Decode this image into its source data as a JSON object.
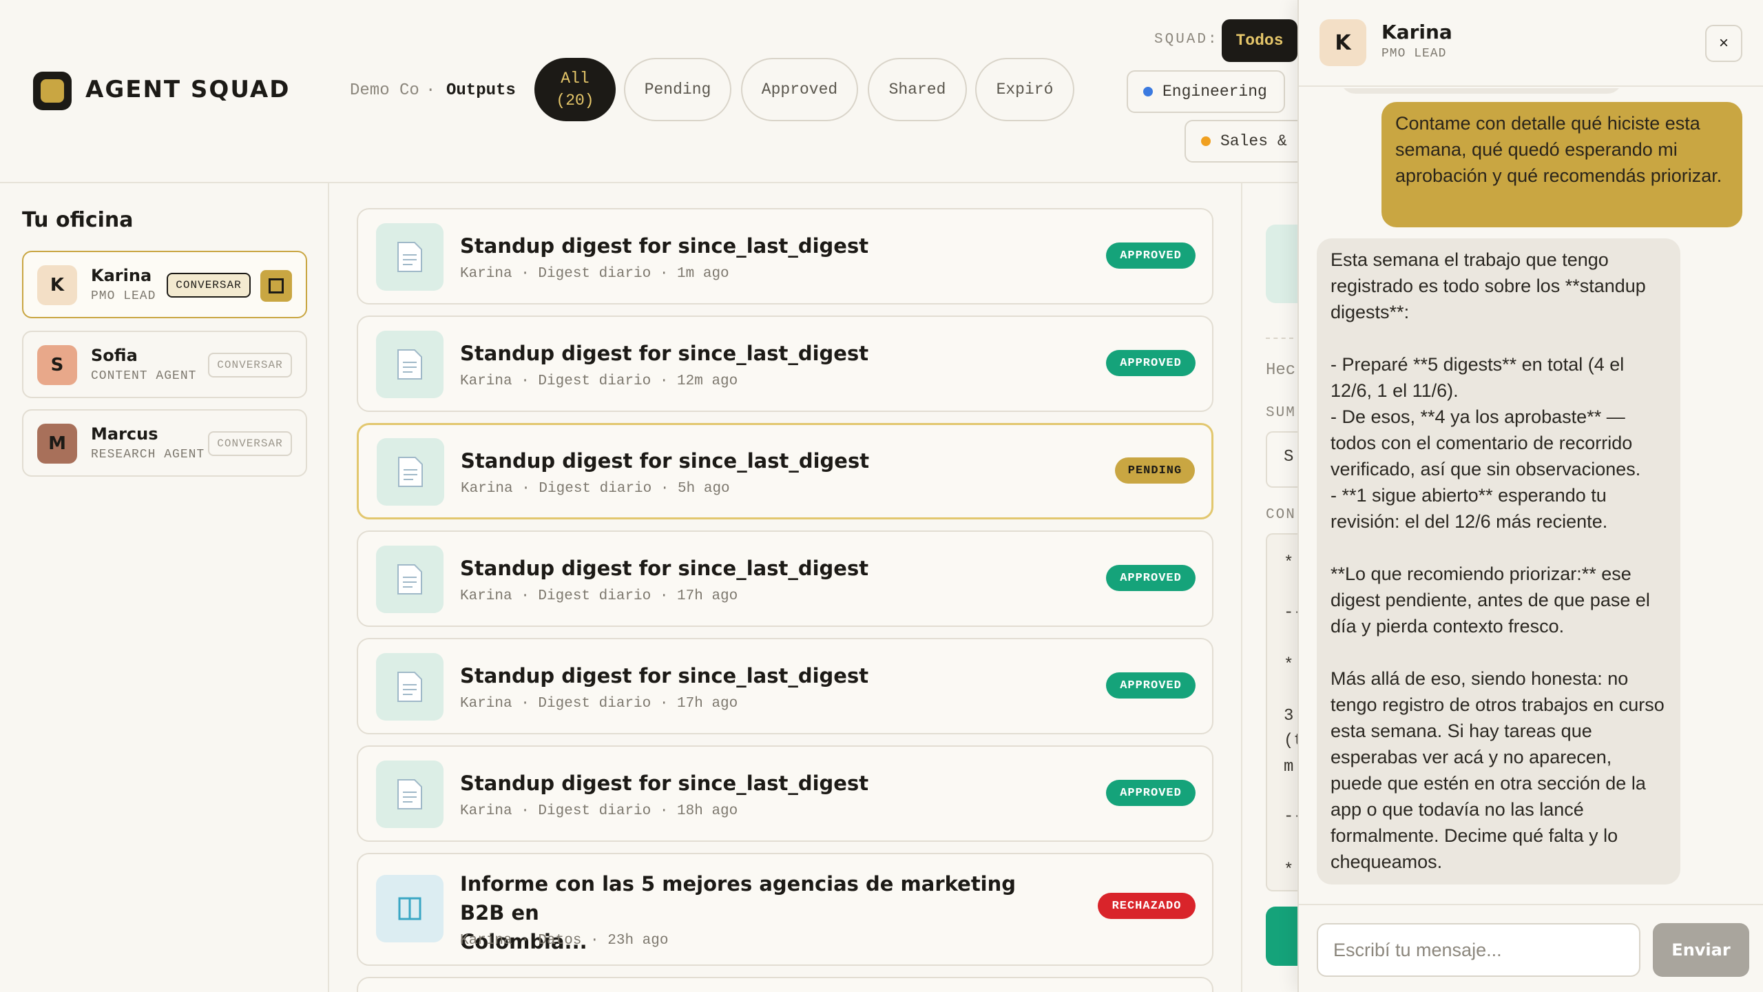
{
  "header": {
    "brand": "AGENT SQUAD",
    "org": "Demo Co",
    "separator": "·",
    "page": "Outputs",
    "filters": [
      {
        "label": "All\n(20)",
        "active": true
      },
      {
        "label": "Pending",
        "active": false
      },
      {
        "label": "Approved",
        "active": false
      },
      {
        "label": "Shared",
        "active": false
      },
      {
        "label": "Expiró",
        "active": false
      }
    ],
    "squad_label": "SQUAD:",
    "squad_selected": "Todos",
    "squads": [
      {
        "label": "Engineering",
        "color": "#3b7ae0"
      },
      {
        "label": "Sales &",
        "color": "#f0a020"
      }
    ]
  },
  "sidebar": {
    "title": "Tu oficina",
    "agents": [
      {
        "initial": "K",
        "name": "Karina",
        "role": "PMO LEAD",
        "action": "CONVERSAR",
        "selected": true,
        "avatar_bg": "#f3dfc6",
        "avatar_fg": "#1c1a16"
      },
      {
        "initial": "S",
        "name": "Sofia",
        "role": "CONTENT AGENT",
        "action": "CONVERSAR",
        "selected": false,
        "avatar_bg": "#e8a88a",
        "avatar_fg": "#1c1a16"
      },
      {
        "initial": "M",
        "name": "Marcus",
        "role": "RESEARCH AGENT",
        "action": "CONVERSAR",
        "selected": false,
        "avatar_bg": "#a8705a",
        "avatar_fg": "#1c1a16"
      }
    ]
  },
  "feed": {
    "items": [
      {
        "title": "Standup digest for since_last_digest",
        "meta": "Karina · Digest diario · 1m ago",
        "status": "APPROVED",
        "icon": "document-icon"
      },
      {
        "title": "Standup digest for since_last_digest",
        "meta": "Karina · Digest diario · 12m ago",
        "status": "APPROVED",
        "icon": "document-icon"
      },
      {
        "title": "Standup digest for since_last_digest",
        "meta": "Karina · Digest diario · 5h ago",
        "status": "PENDING",
        "icon": "document-icon"
      },
      {
        "title": "Standup digest for since_last_digest",
        "meta": "Karina · Digest diario · 17h ago",
        "status": "APPROVED",
        "icon": "document-icon"
      },
      {
        "title": "Standup digest for since_last_digest",
        "meta": "Karina · Digest diario · 17h ago",
        "status": "APPROVED",
        "icon": "document-icon"
      },
      {
        "title": "Standup digest for since_last_digest",
        "meta": "Karina · Digest diario · 18h ago",
        "status": "APPROVED",
        "icon": "document-icon"
      },
      {
        "title": "Informe con las 5 mejores agencias de marketing B2B en\nColombia...",
        "meta": "Karina · Datos · 23h ago",
        "status": "RECHAZADO",
        "icon": "table-icon"
      }
    ]
  },
  "detail": {
    "label_hec": "Hec",
    "label_sum": "SUM",
    "sum_value": "S",
    "label_con": "CON",
    "content_lines": [
      "*",
      "--",
      "*",
      "3",
      "(t",
      "m",
      "--",
      "*"
    ]
  },
  "chat": {
    "agent_initial": "K",
    "agent_name": "Karina",
    "agent_role": "PMO LEAD",
    "close": "×",
    "messages": [
      {
        "from": "user",
        "text": "Contame con detalle qué hiciste esta semana, qué quedó esperando mi aprobación y qué recomendás priorizar."
      },
      {
        "from": "agent",
        "text": "Esta semana el trabajo que tengo registrado es todo sobre los **standup digests**:\n\n- Preparé **5 digests** en total (4 el 12/6, 1 el 11/6).\n- De esos, **4 ya los aprobaste** — todos con el comentario de recorrido verificado, así que sin observaciones.\n- **1 sigue abierto** esperando tu revisión: el del 12/6 más reciente.\n\n**Lo que recomiendo priorizar:** ese digest pendiente, antes de que pase el día y pierda contexto fresco.\n\nMás allá de eso, siendo honesta: no tengo registro de otros trabajos en curso esta semana. Si hay tareas que esperabas ver acá y no aparecen, puede que estén en otra sección de la app o que todavía no las lancé formalmente. Decime qué falta y lo chequeamos."
      }
    ],
    "input_placeholder": "Escribí tu mensaje...",
    "send_label": "Enviar"
  }
}
